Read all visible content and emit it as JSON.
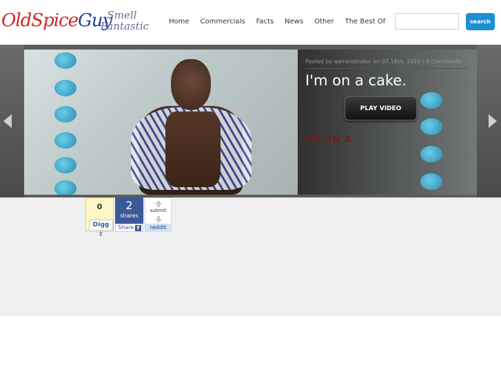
{
  "header": {
    "logo": {
      "part1": "Old",
      "part2": "Spice",
      "part3": "Guy"
    },
    "tagline": "Smell Fantastic",
    "nav": [
      "Home",
      "Commercials",
      "Facts",
      "News",
      "Other",
      "The Best Of"
    ],
    "search": {
      "value": "",
      "button_label": "search"
    }
  },
  "slider": {
    "post_meta": "Posted by administrator on 07.18th, 2010 | 6 Comments",
    "title": "I'm on a cake.",
    "play_label": "PLAY VIDEO",
    "cake_text": "I'M ON A"
  },
  "social": {
    "digg": {
      "count": "0",
      "label": "Digg"
    },
    "facebook": {
      "count": "2",
      "count_label": "shares",
      "share_label": "Share"
    },
    "reddit": {
      "submit_label": "submit",
      "label": "reddit"
    }
  },
  "colors": {
    "accent": "#1c8fd6",
    "logo_red": "#d32525",
    "logo_blue": "#1f3f9a",
    "facebook": "#3b5998"
  }
}
